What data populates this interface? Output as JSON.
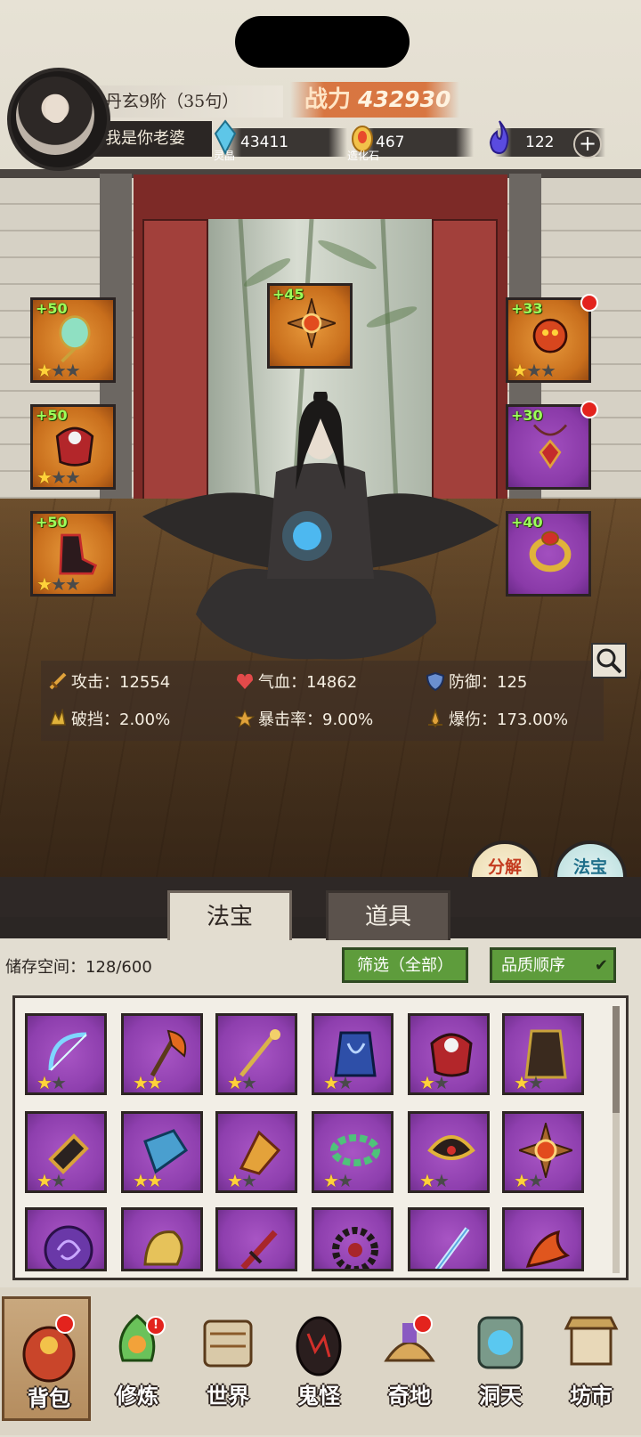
{
  "player": {
    "realm": "丹玄9阶（35句）",
    "name": "我是你老婆",
    "power_label": "战力",
    "power_value": "432930"
  },
  "resources": [
    {
      "icon": "spirit-crystal-icon",
      "caption": "灵晶",
      "value": "43411"
    },
    {
      "icon": "creation-stone-icon",
      "caption": "造化石",
      "value": "467"
    },
    {
      "icon": "blue-flame-icon",
      "caption": "",
      "value": "122"
    }
  ],
  "equip_slots": [
    {
      "id": "left-1",
      "level": "+50",
      "rarity": "orange",
      "stars_on": 1,
      "stars_total": 3,
      "icon": "jade-fan-icon"
    },
    {
      "id": "left-2",
      "level": "+50",
      "rarity": "orange",
      "stars_on": 1,
      "stars_total": 3,
      "icon": "demon-armor-icon"
    },
    {
      "id": "left-3",
      "level": "+50",
      "rarity": "orange",
      "stars_on": 1,
      "stars_total": 3,
      "icon": "dark-boots-icon"
    },
    {
      "id": "center",
      "level": "+45",
      "rarity": "orange",
      "stars_on": 0,
      "stars_total": 0,
      "icon": "spiked-orb-icon"
    },
    {
      "id": "right-1",
      "level": "+33",
      "rarity": "orange",
      "stars_on": 1,
      "stars_total": 3,
      "icon": "fire-beast-icon",
      "alert": true
    },
    {
      "id": "right-2",
      "level": "+30",
      "rarity": "purple",
      "stars_on": 0,
      "stars_total": 0,
      "icon": "red-pendant-icon",
      "alert": true
    },
    {
      "id": "right-3",
      "level": "+40",
      "rarity": "purple",
      "stars_on": 0,
      "stars_total": 0,
      "icon": "gold-ring-icon"
    }
  ],
  "stats": [
    {
      "icon": "sword-icon",
      "label": "攻击：",
      "value": "12554"
    },
    {
      "icon": "heart-icon",
      "label": "气血：",
      "value": "14862"
    },
    {
      "icon": "shield-icon",
      "label": "防御：",
      "value": "125"
    },
    {
      "icon": "break-icon",
      "label": "破挡：",
      "value": "2.00%"
    },
    {
      "icon": "crit-icon",
      "label": "暴击率：",
      "value": "9.00%"
    },
    {
      "icon": "crit-damage-icon",
      "label": "爆伤：",
      "value": "173.00%"
    }
  ],
  "action_buttons": {
    "decompose": "分解\n再造",
    "synthesize": "法宝\n合成"
  },
  "tabs": {
    "treasure": "法宝",
    "items": "道具"
  },
  "inventory": {
    "storage_label": "储存空间：",
    "storage_value": "128/600",
    "filter_label": "筛选（全部）",
    "sort_label": "品质顺序",
    "sort_check": "✔",
    "rows": [
      [
        {
          "icon": "ice-bow-icon",
          "stars_on": 1
        },
        {
          "icon": "flame-axe-icon",
          "stars_on": 2
        },
        {
          "icon": "golden-staff-icon",
          "stars_on": 1
        },
        {
          "icon": "blue-robe-icon",
          "stars_on": 1
        },
        {
          "icon": "demon-armor-icon",
          "stars_on": 1
        },
        {
          "icon": "dark-cloak-icon",
          "stars_on": 1
        }
      ],
      [
        {
          "icon": "gauntlet-icon",
          "stars_on": 1
        },
        {
          "icon": "ice-boots-icon",
          "stars_on": 2
        },
        {
          "icon": "flame-boots-icon",
          "stars_on": 1
        },
        {
          "icon": "jade-wreath-icon",
          "stars_on": 1
        },
        {
          "icon": "gold-mask-icon",
          "stars_on": 1
        },
        {
          "icon": "spiked-orb-icon",
          "stars_on": 1
        }
      ],
      [
        {
          "icon": "purple-orb-icon",
          "stars_on": 0
        },
        {
          "icon": "gold-beast-icon",
          "stars_on": 0
        },
        {
          "icon": "red-dagger-icon",
          "stars_on": 0
        },
        {
          "icon": "dark-wheel-icon",
          "stars_on": 0
        },
        {
          "icon": "ice-sword-icon",
          "stars_on": 0
        },
        {
          "icon": "fire-bird-icon",
          "stars_on": 0
        }
      ]
    ]
  },
  "bottom_nav": [
    {
      "label": "背包",
      "icon": "backpack-icon",
      "active": true,
      "alert": ""
    },
    {
      "label": "修炼",
      "icon": "cultivate-icon",
      "active": false,
      "alert": "!"
    },
    {
      "label": "世界",
      "icon": "world-icon",
      "active": false,
      "alert": ""
    },
    {
      "label": "鬼怪",
      "icon": "ghost-egg-icon",
      "active": false,
      "alert": ""
    },
    {
      "label": "奇地",
      "icon": "wonderland-icon",
      "active": false,
      "alert": ""
    },
    {
      "label": "洞天",
      "icon": "portal-icon",
      "active": false,
      "alert": ""
    },
    {
      "label": "坊市",
      "icon": "market-icon",
      "active": false,
      "alert": ""
    }
  ],
  "colors": {
    "power_accent": "#d66428",
    "orange_rarity": "#c86e1c",
    "purple_rarity": "#8a3aa8",
    "filter_green": "#5e9c3c",
    "level_green": "#9cff5a",
    "alert_red": "#e3231d"
  }
}
